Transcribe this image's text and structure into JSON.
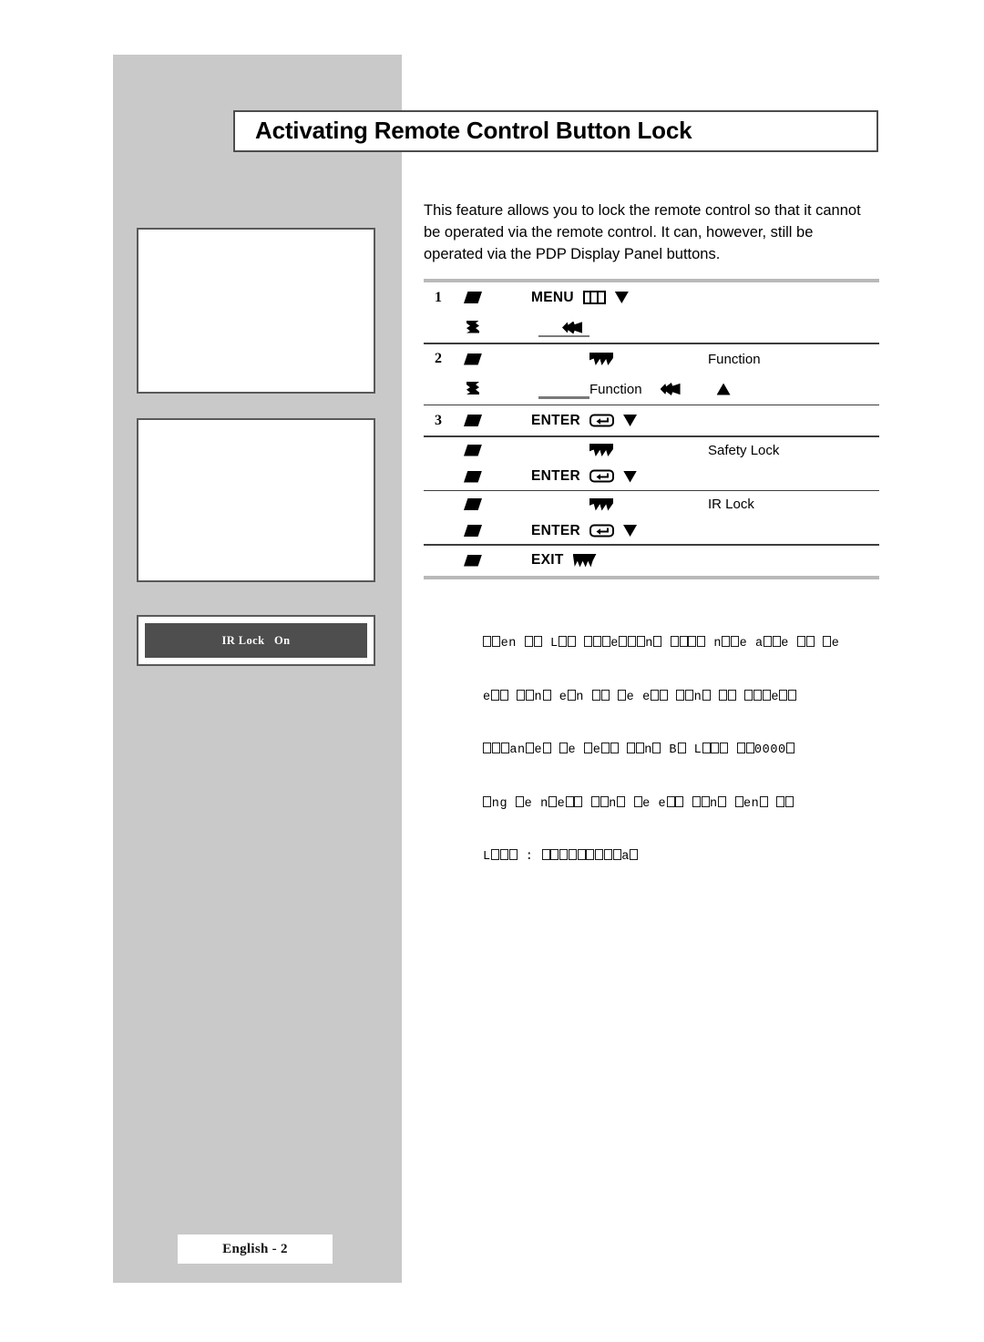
{
  "page": {
    "title": "Activating Remote Control Button Lock",
    "footer_label": "English - 2",
    "background_color": "#ffffff",
    "panel_color": "#c9c9c9",
    "rule_color": "#b9b9b9"
  },
  "intro": {
    "line1": "This feature allows you to lock the remote control so that it cannot",
    "line2": "be operated via the remote control. It can, however, still be",
    "line3": "operated via the PDP Display Panel buttons."
  },
  "sidebar": {
    "illustration_1_alt": "",
    "illustration_2_alt": "",
    "osd_text": "IR Lock   On"
  },
  "steps": [
    {
      "number": "1",
      "press_label": "MENU",
      "press_icon": "menu-key-icon",
      "press_arrow": "triangle-down-icon",
      "result_icon": "arrow-left-icon",
      "result_label": ""
    },
    {
      "number": "2",
      "press_icon": "arrow-down-jagged-icon",
      "press_label": "",
      "press_text": "Function",
      "result_text": "Function",
      "result_icon_left": "arrow-left-icon",
      "result_icon_up": "triangle-up-icon"
    },
    {
      "number": "3",
      "press_label": "ENTER",
      "press_icon": "enter-key-icon",
      "press_arrow": "triangle-down-icon"
    },
    {
      "number": "",
      "row_a_icon": "arrow-down-jagged-icon",
      "row_a_text": "Safety Lock",
      "row_b_label": "ENTER",
      "row_b_icon": "enter-key-icon",
      "row_b_arrow": "triangle-down-icon"
    },
    {
      "number": "",
      "row_a_icon": "arrow-down-jagged-icon",
      "row_a_text": "IR Lock",
      "row_b_label": "ENTER",
      "row_b_icon": "enter-key-icon",
      "row_b_arrow": "triangle-down-icon"
    },
    {
      "number": "",
      "exit_label": "EXIT",
      "exit_icon": "arrow-down-wide-icon"
    }
  ],
  "step_labels": {
    "num_1": "1",
    "num_2": "2",
    "num_3": "3",
    "menu": "MENU",
    "enter": "ENTER",
    "exit": "EXIT",
    "function_a": "Function",
    "function_b": "Function",
    "safety_lock": "Safety Lock",
    "ir_lock": "IR Lock"
  },
  "note": {
    "description": "Degraded scan: most glyphs render as missing-character boxes",
    "lines": [
      "□□en □□ L□□ □□□e□□□n□ □□□□ n□□e a□□e □□ □e",
      "e□□ □□n□ e□n □□ □e e□□ □□n□ □□ □□□e□□",
      "□□□an□e□ □e □e□□ □□n□ B□ L□□□ □□0000□",
      "□ng □e n□e□□ □□n□ □e e□□ □□n□ □en□ □□",
      "L□□□ : □□□□□□□□□a□"
    ]
  }
}
